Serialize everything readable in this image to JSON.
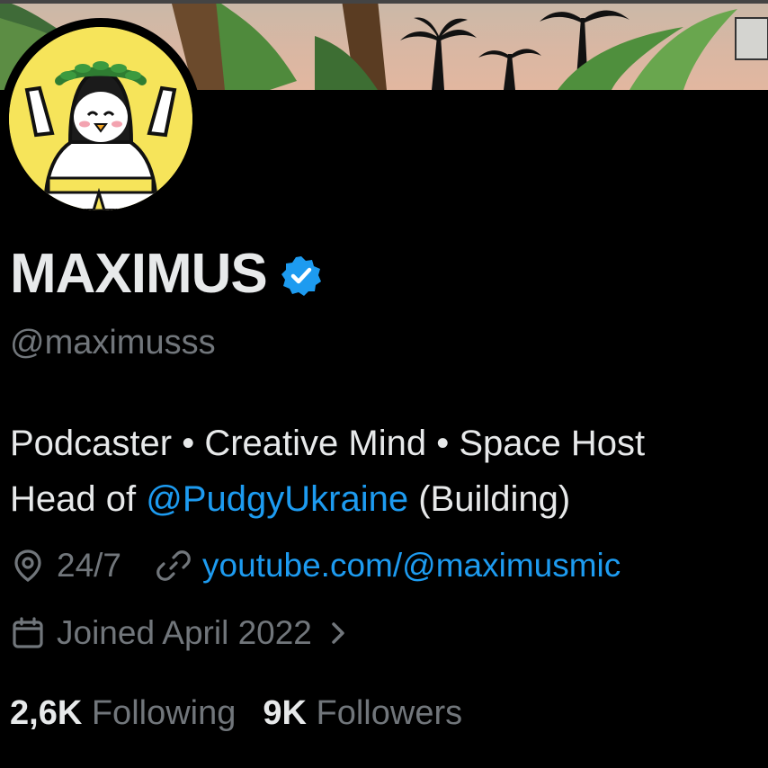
{
  "profile": {
    "name": "MAXIMUS",
    "handle": "@maximusss",
    "verified": true,
    "bio": {
      "line1": "Podcaster • Creative Mind • Space Host",
      "line2_prefix": "Head of ",
      "line2_mention": "@PudgyUkraine",
      "line2_suffix": " (Building)"
    },
    "location": "24/7",
    "website": "youtube.com/@maximusmic",
    "joined": "Joined April 2022",
    "following_count": "2,6K",
    "following_label": "Following",
    "followers_count": "9K",
    "followers_label": "Followers"
  },
  "icons": {
    "verified": "verified-badge-icon",
    "location": "location-pin-icon",
    "link": "link-icon",
    "calendar": "calendar-icon",
    "chevron": "chevron-right-icon"
  },
  "colors": {
    "background": "#000000",
    "primary_text": "#e7e9ea",
    "secondary_text": "#71767b",
    "accent": "#1d9bf0",
    "avatar_bg": "#f6e45a"
  }
}
